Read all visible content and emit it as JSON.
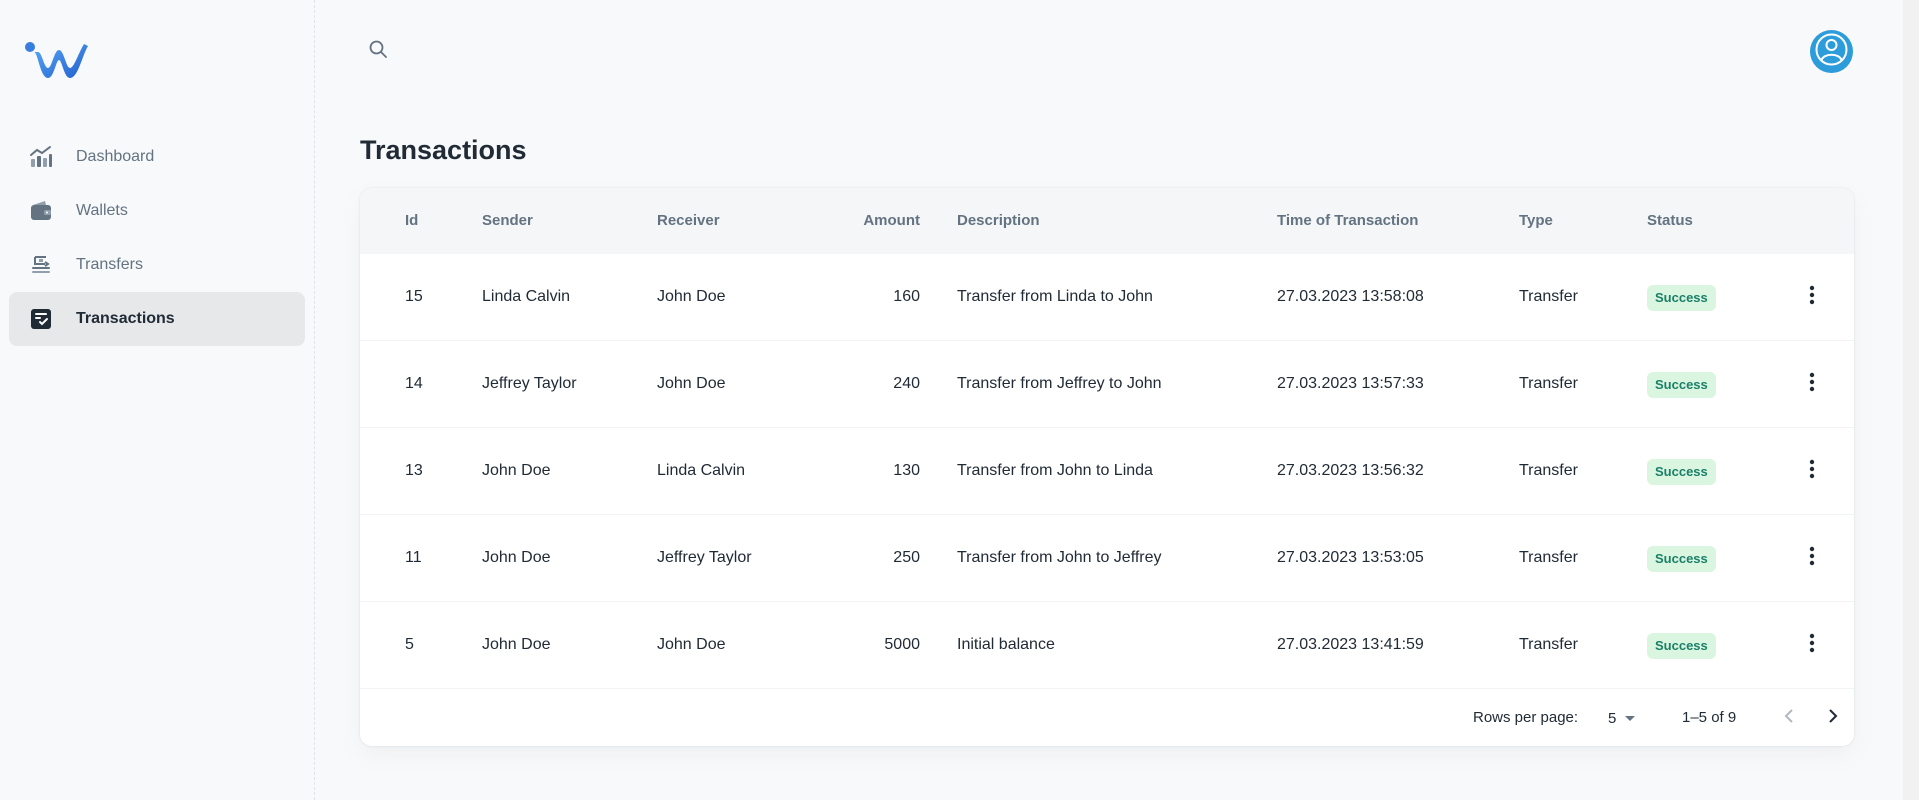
{
  "sidebar": {
    "logo": "wallet-app-logo",
    "items": [
      {
        "label": "Dashboard",
        "icon": "chart-icon"
      },
      {
        "label": "Wallets",
        "icon": "wallet-icon"
      },
      {
        "label": "Transfers",
        "icon": "transfer-icon"
      },
      {
        "label": "Transactions",
        "icon": "receipt-icon",
        "active": true
      }
    ]
  },
  "header": {
    "search_icon": "search-icon",
    "avatar_icon": "user-avatar-icon"
  },
  "page": {
    "title": "Transactions"
  },
  "table": {
    "columns": [
      "Id",
      "Sender",
      "Receiver",
      "Amount",
      "Description",
      "Time of Transaction",
      "Type",
      "Status"
    ],
    "rows": [
      {
        "id": "15",
        "sender": "Linda Calvin",
        "receiver": "John Doe",
        "amount": "160",
        "description": "Transfer from Linda to John",
        "time": "27.03.2023 13:58:08",
        "type": "Transfer",
        "status": "Success"
      },
      {
        "id": "14",
        "sender": "Jeffrey Taylor",
        "receiver": "John Doe",
        "amount": "240",
        "description": "Transfer from Jeffrey to John",
        "time": "27.03.2023 13:57:33",
        "type": "Transfer",
        "status": "Success"
      },
      {
        "id": "13",
        "sender": "John Doe",
        "receiver": "Linda Calvin",
        "amount": "130",
        "description": "Transfer from John to Linda",
        "time": "27.03.2023 13:56:32",
        "type": "Transfer",
        "status": "Success"
      },
      {
        "id": "11",
        "sender": "John Doe",
        "receiver": "Jeffrey Taylor",
        "amount": "250",
        "description": "Transfer from John to Jeffrey",
        "time": "27.03.2023 13:53:05",
        "type": "Transfer",
        "status": "Success"
      },
      {
        "id": "5",
        "sender": "John Doe",
        "receiver": "John Doe",
        "amount": "5000",
        "description": "Initial balance",
        "time": "27.03.2023 13:41:59",
        "type": "Transfer",
        "status": "Success"
      }
    ]
  },
  "pagination": {
    "rows_per_page_label": "Rows per page:",
    "rows_per_page_value": "5",
    "range": "1–5 of 9"
  },
  "colors": {
    "accent": "#2d9cdb",
    "success_bg": "#dbf6e0",
    "success_text": "#1b806a",
    "active_nav_bg": "#e6e8ea"
  }
}
